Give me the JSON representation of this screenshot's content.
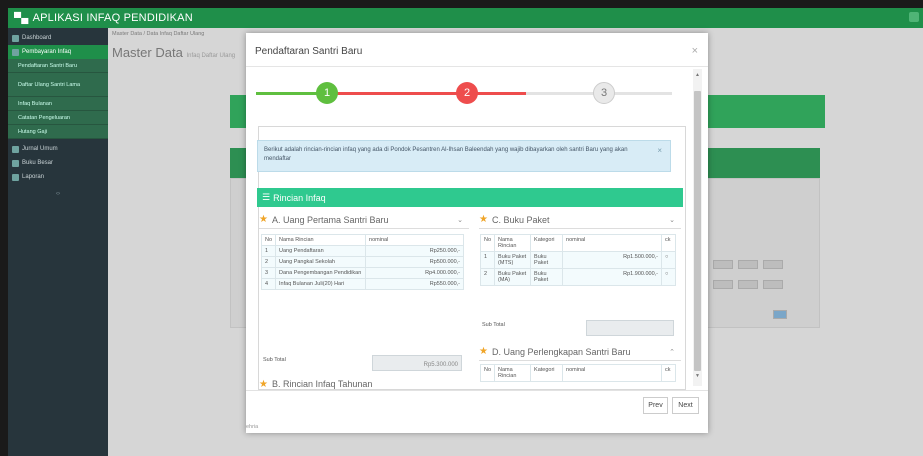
{
  "app": {
    "title": "APLIKASI INFAQ PENDIDIKAN"
  },
  "sidebar": {
    "items": [
      {
        "label": "Dashboard"
      },
      {
        "label": "Pembayaran Infaq"
      }
    ],
    "sub_items": [
      {
        "label": "Pendaftaran Santri Baru"
      },
      {
        "label": "Daftar Ulang Santri Lama"
      },
      {
        "label": "Infaq Bulanan"
      },
      {
        "label": "Catatan Pengeluaran"
      },
      {
        "label": "Hutang Gaji"
      }
    ],
    "items_after": [
      {
        "label": "Jurnal Umum"
      },
      {
        "label": "Buku Besar"
      },
      {
        "label": "Laporan"
      }
    ]
  },
  "breadcrumb": "Master Data / Data Infaq Daftar Ulang",
  "page": {
    "title": "Master Data",
    "subtitle": "Infaq Daftar Ulang"
  },
  "modal": {
    "title": "Pendaftaran Santri Baru",
    "close": "×",
    "steps": [
      {
        "label": "1",
        "color": "#5fbf3f"
      },
      {
        "label": "2",
        "color": "#ee4d4d"
      },
      {
        "label": "3",
        "color": "#e9e9e9"
      }
    ],
    "alert": "Berikut adalah rincian-rincian infaq yang ada di Pondok Pesantren Al-Ihsan Baleendah yang wajib dibayarkan oleh santri Baru yang akan mendaftar",
    "rincian_title": "Rincian Infaq",
    "panel_a": {
      "title": "A. Uang Pertama Santri Baru",
      "headers": [
        "No",
        "Nama Rincian",
        "nominal"
      ],
      "rows": [
        {
          "no": "1",
          "nama": "Uang Pendaftaran",
          "nominal": "Rp250.000,-"
        },
        {
          "no": "2",
          "nama": "Uang Pangkal Sekolah",
          "nominal": "Rp500.000,-"
        },
        {
          "no": "3",
          "nama": "Dana Pengembangan Pendidikan",
          "nominal": "Rp4.000.000,-"
        },
        {
          "no": "4",
          "nama": "Infaq Bulanan Juli(20) Hari",
          "nominal": "Rp550.000,-"
        }
      ],
      "subtotal_label": "Sub Total",
      "subtotal_value": "Rp5.300.000"
    },
    "panel_b": {
      "title": "B. Rincian Infaq Tahunan"
    },
    "panel_c": {
      "title": "C. Buku Paket",
      "headers": [
        "No",
        "Nama Rincian",
        "Kategori",
        "nominal",
        "ck"
      ],
      "rows": [
        {
          "no": "1",
          "nama": "Buku Paket (MTS)",
          "kategori": "Buku Paket",
          "nominal": "Rp1.500.000,-"
        },
        {
          "no": "2",
          "nama": "Buku Paket (MA)",
          "kategori": "Buku Paket",
          "nominal": "Rp1.900.000,-"
        }
      ],
      "subtotal_label": "Sub Total",
      "subtotal_value": ""
    },
    "panel_d": {
      "title": "D. Uang Perlengkapan Santri Baru",
      "headers": [
        "No",
        "Nama Rincian",
        "Kategori",
        "nominal",
        "ck"
      ]
    },
    "prev_label": "Prev",
    "next_label": "Next"
  },
  "status_text": "ehria"
}
